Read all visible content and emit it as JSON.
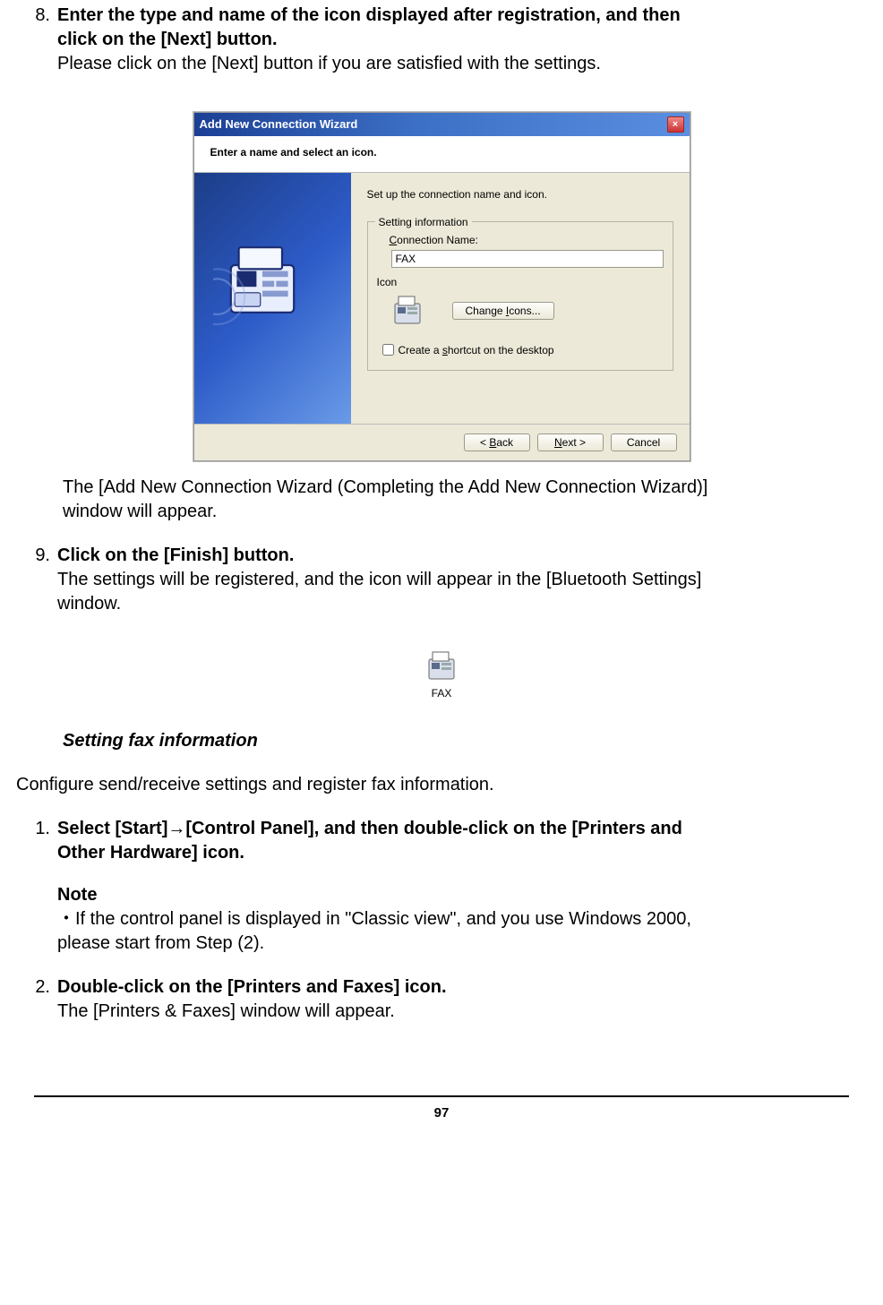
{
  "step8": {
    "number": "8.",
    "title_line1": "Enter the type and name of the icon displayed after registration, and then",
    "title_line2": "click on the [Next] button.",
    "body": "Please click on the [Next] button if you are satisfied with the settings.",
    "after_wizard1": "The [Add New Connection Wizard (Completing the Add New Connection Wizard)]",
    "after_wizard2": "window will appear."
  },
  "wizard": {
    "title": "Add New Connection Wizard",
    "banner": "Enter a name and select an icon.",
    "instruction": "Set up the connection name and icon.",
    "legend": "Setting information",
    "conn_label_pre": "C",
    "conn_label_post": "onnection Name:",
    "conn_value": "FAX",
    "icon_label": "Icon",
    "change_btn_pre": "Change ",
    "change_btn_u": "I",
    "change_btn_post": "cons...",
    "shortcut_pre": "Create a ",
    "shortcut_u": "s",
    "shortcut_post": "hortcut on the desktop",
    "back_pre": "< ",
    "back_u": "B",
    "back_post": "ack",
    "next_u": "N",
    "next_post": "ext >",
    "cancel": "Cancel"
  },
  "fax_icon_label": "FAX",
  "step9": {
    "number": "9.",
    "title": "Click on the [Finish] button.",
    "body1": "The settings will be registered, and the icon will appear in the [Bluetooth Settings]",
    "body2": "window."
  },
  "heading_fax_info": "Setting fax information",
  "configure_text": "Configure send/receive settings and register fax information.",
  "step1": {
    "number": "1.",
    "title_line1": "Select [Start]→[Control Panel], and then double-click on the [Printers and",
    "title_line2": "Other Hardware] icon.",
    "note_label": "Note",
    "note_body1": "・If the control panel is displayed in \"Classic view\", and you use Windows 2000,",
    "note_body2": "please start from Step (2)."
  },
  "step2": {
    "number": "2.",
    "title": "Double-click on the [Printers and Faxes] icon.",
    "body": "The [Printers & Faxes] window will appear."
  },
  "page_number": "97"
}
